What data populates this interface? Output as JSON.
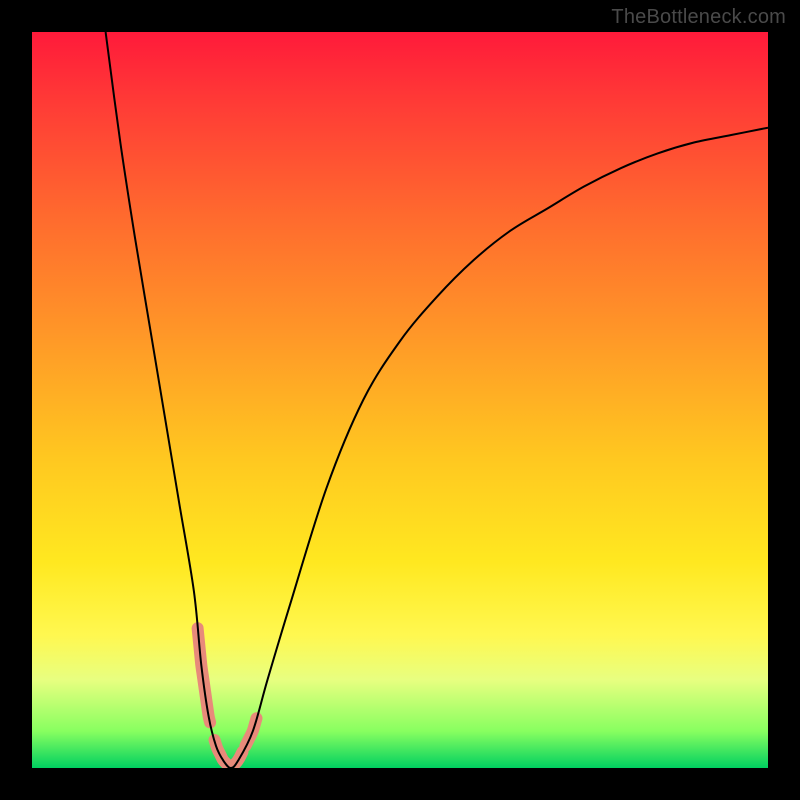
{
  "watermark": "TheBottleneck.com",
  "chart_data": {
    "type": "line",
    "title": "",
    "xlabel": "",
    "ylabel": "",
    "xlim": [
      0,
      100
    ],
    "ylim": [
      0,
      100
    ],
    "grid": false,
    "series": [
      {
        "name": "bottleneck-curve",
        "x": [
          10,
          12,
          14,
          16,
          18,
          20,
          22,
          23,
          24,
          25,
          26,
          27,
          28,
          30,
          32,
          35,
          40,
          45,
          50,
          55,
          60,
          65,
          70,
          75,
          80,
          85,
          90,
          95,
          100
        ],
        "values": [
          100,
          85,
          72,
          60,
          48,
          36,
          24,
          14,
          7,
          3,
          1,
          0,
          1,
          5,
          12,
          22,
          38,
          50,
          58,
          64,
          69,
          73,
          76,
          79,
          81.5,
          83.5,
          85,
          86,
          87
        ]
      }
    ],
    "annotations": [
      {
        "name": "highlight-left-descent",
        "x_range": [
          22.5,
          24.2
        ],
        "color": "#e88a7a"
      },
      {
        "name": "highlight-valley-floor",
        "x_range": [
          24.8,
          28.6
        ],
        "color": "#e88a7a"
      },
      {
        "name": "highlight-right-ascent",
        "x_range": [
          29.0,
          30.5
        ],
        "color": "#e88a7a"
      }
    ]
  }
}
